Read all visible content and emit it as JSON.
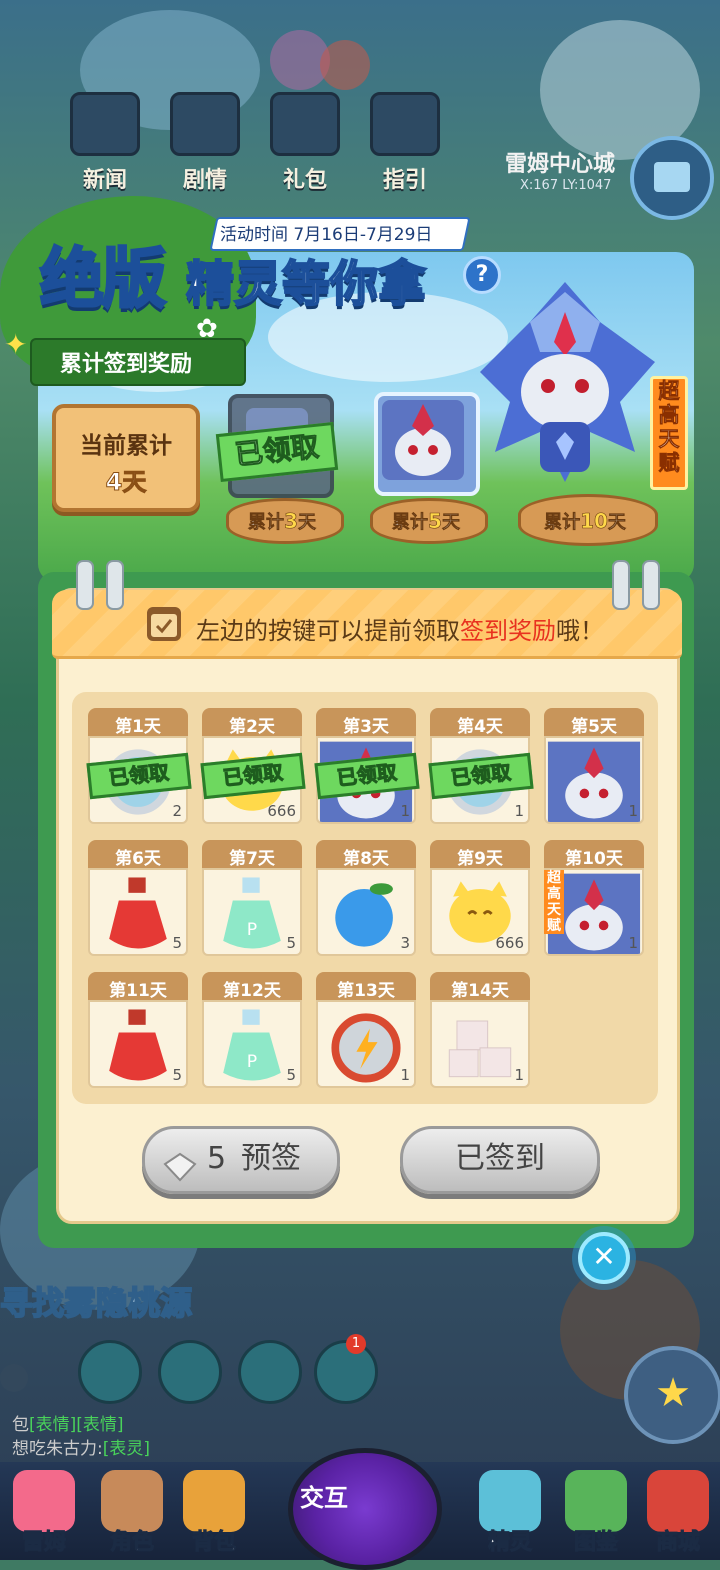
{
  "topnav": [
    {
      "label": "新闻"
    },
    {
      "label": "剧情"
    },
    {
      "label": "礼包"
    },
    {
      "label": "指引"
    }
  ],
  "location": {
    "name": "雷姆中心城",
    "coords": "X:167 LY:1047"
  },
  "event": {
    "time": "活动时间 7月16日-7月29日",
    "title_main": "绝版",
    "title_sub": "精灵等你拿",
    "help": "?",
    "cumulative_ribbon": "累计签到奖励",
    "current_label": "当前累计",
    "current_value": "4天",
    "super_tag": "超高天赋",
    "milestones": [
      {
        "prefix": "累计",
        "num": "3",
        "suffix": "天",
        "status": "已领取"
      },
      {
        "prefix": "累计",
        "num": "5",
        "suffix": "天",
        "status": ""
      },
      {
        "prefix": "累计",
        "num": "10",
        "suffix": "天",
        "status": ""
      }
    ]
  },
  "notebook": {
    "hint_pre": "左边的按键可以提前领取",
    "hint_highlight": "签到奖励",
    "hint_post": "哦！",
    "claimed_label": "已领取",
    "super_tag": "超高天赋",
    "days": [
      {
        "day": "第1天",
        "qty": "2",
        "item": "gear-token",
        "claimed": true
      },
      {
        "day": "第2天",
        "qty": "666",
        "item": "cat-coin",
        "claimed": true
      },
      {
        "day": "第3天",
        "qty": "1",
        "item": "spirit-portrait",
        "claimed": true
      },
      {
        "day": "第4天",
        "qty": "1",
        "item": "gear-token",
        "claimed": true
      },
      {
        "day": "第5天",
        "qty": "1",
        "item": "spirit-portrait",
        "claimed": false
      },
      {
        "day": "第6天",
        "qty": "5",
        "item": "red-potion",
        "claimed": false
      },
      {
        "day": "第7天",
        "qty": "5",
        "item": "p-potion",
        "claimed": false
      },
      {
        "day": "第8天",
        "qty": "3",
        "item": "blue-fruit",
        "claimed": false
      },
      {
        "day": "第9天",
        "qty": "666",
        "item": "cat-coin",
        "claimed": false
      },
      {
        "day": "第10天",
        "qty": "1",
        "item": "spirit-portrait",
        "claimed": false
      },
      {
        "day": "第11天",
        "qty": "5",
        "item": "red-potion",
        "claimed": false
      },
      {
        "day": "第12天",
        "qty": "5",
        "item": "p-potion",
        "claimed": false
      },
      {
        "day": "第13天",
        "qty": "1",
        "item": "energy-gear",
        "claimed": false
      },
      {
        "day": "第14天",
        "qty": "1",
        "item": "sugar-cubes",
        "claimed": false
      }
    ],
    "presign_count": "5",
    "presign_label": "预签",
    "signed_label": "已签到"
  },
  "quest_banner": "寻找雾隐桃源",
  "chat": [
    {
      "prefix": "包",
      "tags": "[表情][表情]"
    },
    {
      "prefix": "想吃朱古力:",
      "tags": "[表灵]"
    }
  ],
  "bottom_nav": [
    {
      "label": "雷姆"
    },
    {
      "label": "角色"
    },
    {
      "label": "背包"
    },
    {
      "label": "交互"
    },
    {
      "label": "精灵"
    },
    {
      "label": "图鉴"
    },
    {
      "label": "商城"
    }
  ],
  "badge_count": "1",
  "colors": {
    "accent": "#e8321f",
    "frame_green": "#3e9a50",
    "tab_brown": "#c8955a",
    "claimed_green": "#6ed85f"
  }
}
